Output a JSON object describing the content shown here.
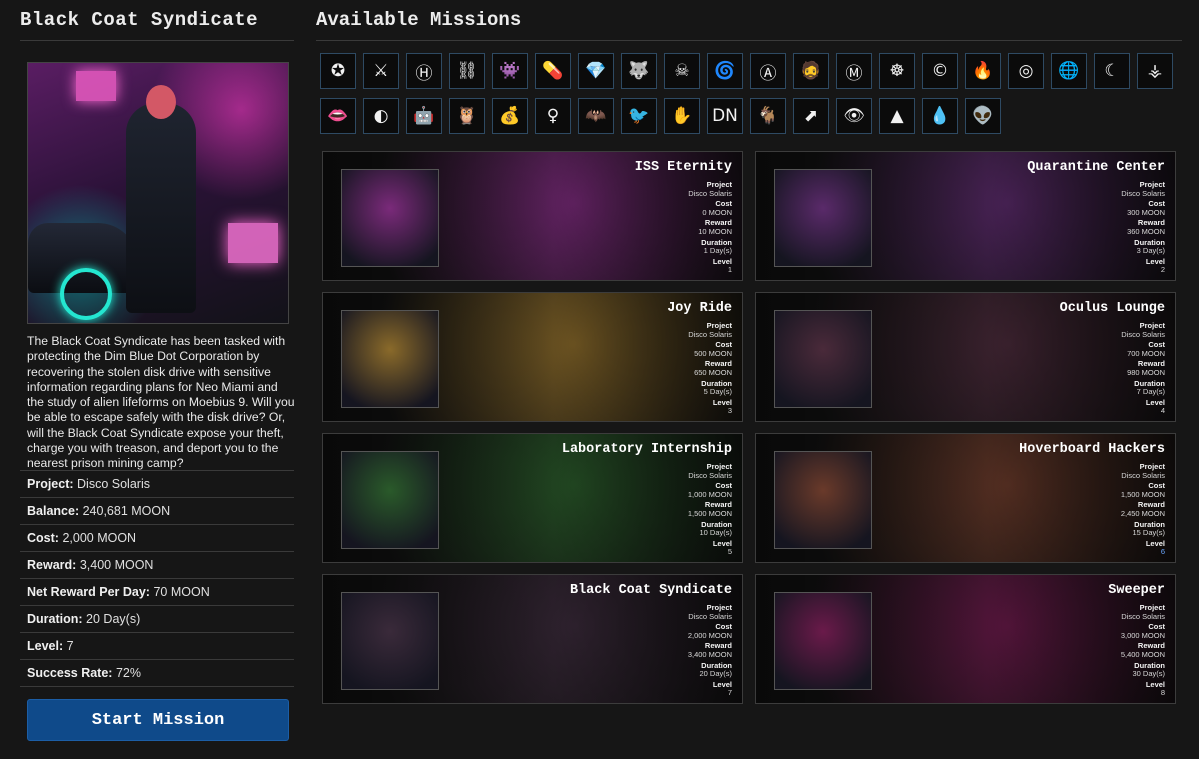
{
  "mission_detail": {
    "title": "Black Coat Syndicate",
    "description": "The Black Coat Syndicate has been tasked with protecting the Dim Blue Dot Corporation by recovering the stolen disk drive with sensitive information regarding plans for Neo Miami and the study of alien lifeforms on Moebius 9. Will you be able to escape safely with the disk drive? Or, will the Black Coat Syndicate expose your theft, charge you with treason, and deport you to the nearest prison mining camp?",
    "stats": [
      {
        "label": "Project:",
        "value": "Disco Solaris"
      },
      {
        "label": "Balance:",
        "value": "240,681 MOON"
      },
      {
        "label": "Cost:",
        "value": "2,000 MOON"
      },
      {
        "label": "Reward:",
        "value": "3,400 MOON"
      },
      {
        "label": "Net Reward Per Day:",
        "value": "70 MOON"
      },
      {
        "label": "Duration:",
        "value": "20 Day(s)"
      },
      {
        "label": "Level:",
        "value": "7"
      },
      {
        "label": "Success Rate:",
        "value": "72%"
      }
    ],
    "start_button": "Start Mission"
  },
  "missions_header": "Available Missions",
  "project_icons": [
    {
      "name": "star-emblem-icon",
      "glyph": "✪"
    },
    {
      "name": "blade-emblem-icon",
      "glyph": "⚔"
    },
    {
      "name": "h-circle-icon",
      "glyph": "Ⓗ"
    },
    {
      "name": "chain-emblem-icon",
      "glyph": "⛓"
    },
    {
      "name": "space-invader-icon",
      "glyph": "👾"
    },
    {
      "name": "capsule-icon",
      "glyph": "💊"
    },
    {
      "name": "diamond-icon",
      "glyph": "💎"
    },
    {
      "name": "wolf-emblem-icon",
      "glyph": "🐺"
    },
    {
      "name": "skull-face-icon",
      "glyph": "☠"
    },
    {
      "name": "swirl-icon",
      "glyph": "🌀"
    },
    {
      "name": "a-circle-icon",
      "glyph": "Ⓐ"
    },
    {
      "name": "bearded-face-icon",
      "glyph": "🧔"
    },
    {
      "name": "mipa-logo-icon",
      "glyph": "Ⓜ"
    },
    {
      "name": "triquetra-icon",
      "glyph": "☸"
    },
    {
      "name": "c-circle-icon",
      "glyph": "©"
    },
    {
      "name": "phoenix-icon",
      "glyph": "🔥"
    },
    {
      "name": "aperture-icon",
      "glyph": "◎"
    },
    {
      "name": "globe-face-icon",
      "glyph": "🌐"
    },
    {
      "name": "crescent-ring-icon",
      "glyph": "☾"
    },
    {
      "name": "claw-icon",
      "glyph": "⚶"
    },
    {
      "name": "lips-icon",
      "glyph": "👄"
    },
    {
      "name": "split-circle-icon",
      "glyph": "◐"
    },
    {
      "name": "mech-head-icon",
      "glyph": "🤖"
    },
    {
      "name": "owl-icon",
      "glyph": "🦉"
    },
    {
      "name": "money-bag-icon",
      "glyph": "💰"
    },
    {
      "name": "female-symbol-icon",
      "glyph": "♀"
    },
    {
      "name": "bat-wing-icon",
      "glyph": "🦇"
    },
    {
      "name": "bird-head-icon",
      "glyph": "🐦"
    },
    {
      "name": "hand-sign-icon",
      "glyph": "✋"
    },
    {
      "name": "dn-logo-icon",
      "glyph": "DN"
    },
    {
      "name": "goat-head-icon",
      "glyph": "🐐"
    },
    {
      "name": "arrow-block-icon",
      "glyph": "⬈"
    },
    {
      "name": "eye-circle-icon",
      "glyph": "👁"
    },
    {
      "name": "triangle-icon",
      "glyph": "▲"
    },
    {
      "name": "drop-icon",
      "glyph": "💧"
    },
    {
      "name": "alien-skull-icon",
      "glyph": "👽"
    }
  ],
  "missions": [
    {
      "title": "ISS Eternity",
      "project": "Disco Solaris",
      "cost": "0 MOON",
      "reward": "10 MOON",
      "duration": "1 Day(s)",
      "level": "1",
      "accent": "#7a2a7a"
    },
    {
      "title": "Quarantine Center",
      "project": "Disco Solaris",
      "cost": "300 MOON",
      "reward": "360 MOON",
      "duration": "3 Day(s)",
      "level": "2",
      "accent": "#5a2a6a"
    },
    {
      "title": "Joy Ride",
      "project": "Disco Solaris",
      "cost": "500 MOON",
      "reward": "650 MOON",
      "duration": "5 Day(s)",
      "level": "3",
      "accent": "#8a6a2a"
    },
    {
      "title": "Oculus Lounge",
      "project": "Disco Solaris",
      "cost": "700 MOON",
      "reward": "980 MOON",
      "duration": "7 Day(s)",
      "level": "4",
      "accent": "#4a2a3a"
    },
    {
      "title": "Laboratory Internship",
      "project": "Disco Solaris",
      "cost": "1,000 MOON",
      "reward": "1,500 MOON",
      "duration": "10 Day(s)",
      "level": "5",
      "accent": "#2a5a2a"
    },
    {
      "title": "Hoverboard Hackers",
      "project": "Disco Solaris",
      "cost": "1,500 MOON",
      "reward": "2,450 MOON",
      "duration": "15 Day(s)",
      "level": "6",
      "accent": "#6a3a2a"
    },
    {
      "title": "Black Coat Syndicate",
      "project": "Disco Solaris",
      "cost": "2,000 MOON",
      "reward": "3,400 MOON",
      "duration": "20 Day(s)",
      "level": "7",
      "accent": "#3a2a3a"
    },
    {
      "title": "Sweeper",
      "project": "Disco Solaris",
      "cost": "3,000 MOON",
      "reward": "5,400 MOON",
      "duration": "30 Day(s)",
      "level": "8",
      "accent": "#6a1a4a"
    }
  ],
  "labels": {
    "project": "Project",
    "cost": "Cost",
    "reward": "Reward",
    "duration": "Duration",
    "level": "Level"
  }
}
